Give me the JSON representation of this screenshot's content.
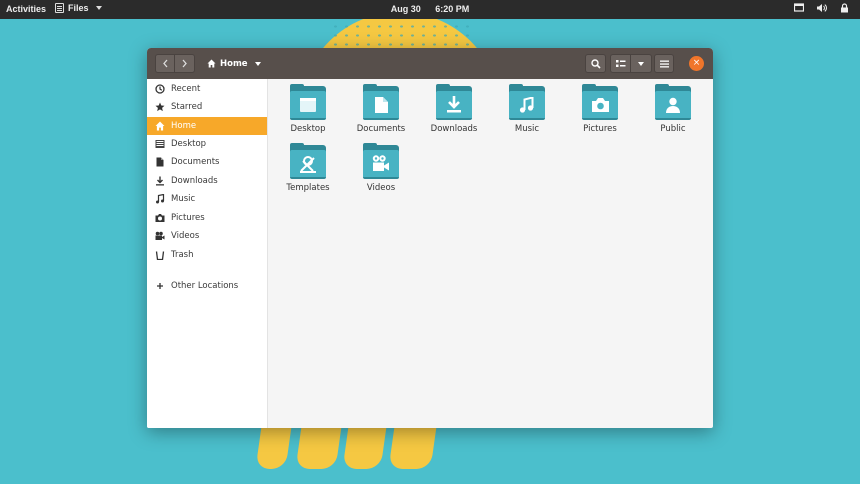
{
  "topbar": {
    "activities": "Activities",
    "app_name": "Files",
    "date": "Aug 30",
    "time": "6:20 PM",
    "tray_icons": [
      "screen-icon",
      "volume-icon",
      "lock-icon"
    ]
  },
  "window": {
    "path_label": "Home",
    "close_glyph": "×"
  },
  "sidebar": {
    "items": [
      {
        "label": "Recent",
        "icon": "clock-icon"
      },
      {
        "label": "Starred",
        "icon": "star-icon"
      },
      {
        "label": "Home",
        "icon": "home-icon",
        "active": true
      },
      {
        "label": "Desktop",
        "icon": "desktop-icon"
      },
      {
        "label": "Documents",
        "icon": "document-icon"
      },
      {
        "label": "Downloads",
        "icon": "download-icon"
      },
      {
        "label": "Music",
        "icon": "music-icon"
      },
      {
        "label": "Pictures",
        "icon": "camera-icon"
      },
      {
        "label": "Videos",
        "icon": "video-icon"
      },
      {
        "label": "Trash",
        "icon": "trash-icon"
      },
      {
        "label": "Other Locations",
        "icon": "plus-icon"
      }
    ]
  },
  "folders": [
    {
      "label": "Desktop",
      "icon": "desktop-icon"
    },
    {
      "label": "Documents",
      "icon": "document-icon"
    },
    {
      "label": "Downloads",
      "icon": "download-icon"
    },
    {
      "label": "Music",
      "icon": "music-icon"
    },
    {
      "label": "Pictures",
      "icon": "camera-icon"
    },
    {
      "label": "Public",
      "icon": "person-icon"
    },
    {
      "label": "Templates",
      "icon": "templates-icon"
    },
    {
      "label": "Videos",
      "icon": "video-icon"
    }
  ],
  "colors": {
    "accent": "#f7a829",
    "headerbar": "#574f4b",
    "folder_front": "#48b3c3",
    "folder_back": "#2f8896",
    "close_button": "#f0752a",
    "wallpaper": "#4bbfcc"
  }
}
